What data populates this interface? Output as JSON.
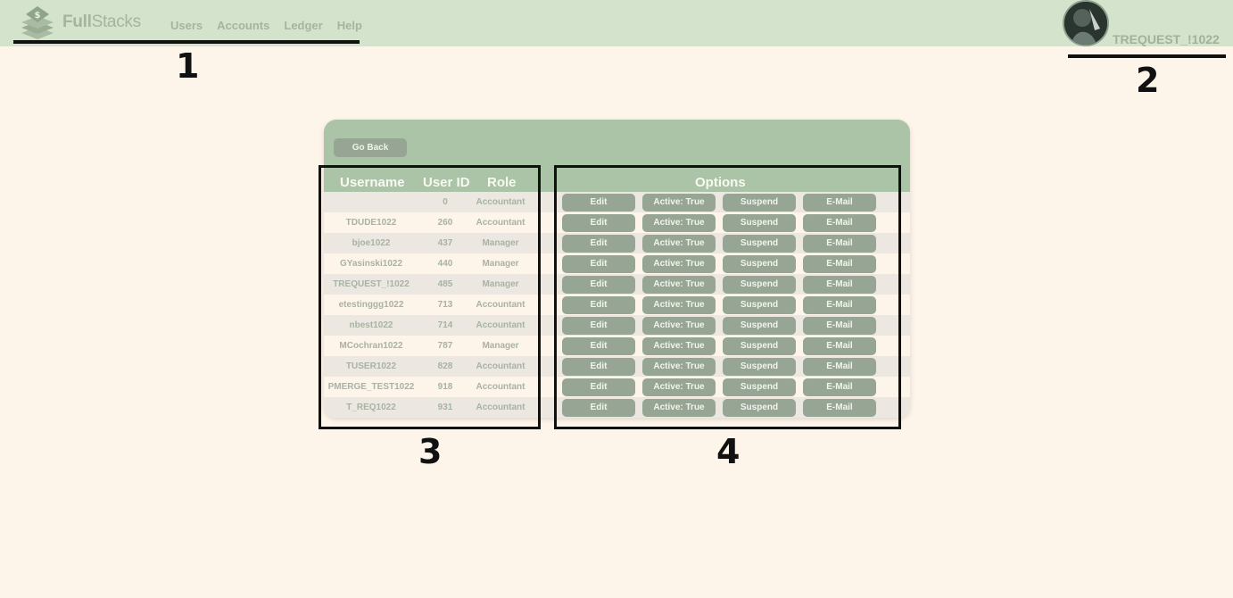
{
  "header": {
    "brand_bold": "Full",
    "brand_rest": "Stacks",
    "nav": [
      "Users",
      "Accounts",
      "Ledger",
      "Help"
    ],
    "username": "TREQUEST_!1022"
  },
  "panel": {
    "go_back": "Go Back",
    "columns": {
      "username": "Username",
      "user_id": "User ID",
      "role": "Role",
      "options": "Options"
    },
    "rows": [
      {
        "username": "",
        "id": "0",
        "role": "Accountant"
      },
      {
        "username": "TDUDE1022",
        "id": "260",
        "role": "Accountant"
      },
      {
        "username": "bjoe1022",
        "id": "437",
        "role": "Manager"
      },
      {
        "username": "GYasinski1022",
        "id": "440",
        "role": "Manager"
      },
      {
        "username": "TREQUEST_!1022",
        "id": "485",
        "role": "Manager"
      },
      {
        "username": "etestinggg1022",
        "id": "713",
        "role": "Accountant"
      },
      {
        "username": "nbest1022",
        "id": "714",
        "role": "Accountant"
      },
      {
        "username": "MCochran1022",
        "id": "787",
        "role": "Manager"
      },
      {
        "username": "TUSER1022",
        "id": "828",
        "role": "Accountant"
      },
      {
        "username": "PMERGE_TEST1022",
        "id": "918",
        "role": "Accountant"
      },
      {
        "username": "T_REQ1022",
        "id": "931",
        "role": "Accountant"
      }
    ],
    "buttons": {
      "edit": "Edit",
      "active": "Active: True",
      "suspend": "Suspend",
      "email": "E-Mail"
    }
  },
  "annotations": [
    "1",
    "2",
    "3",
    "4"
  ],
  "colors": {
    "topbar": "#d4e4cc",
    "background": "#fdf4ea",
    "panel_header": "#abc3a7",
    "button": "#96a594"
  }
}
